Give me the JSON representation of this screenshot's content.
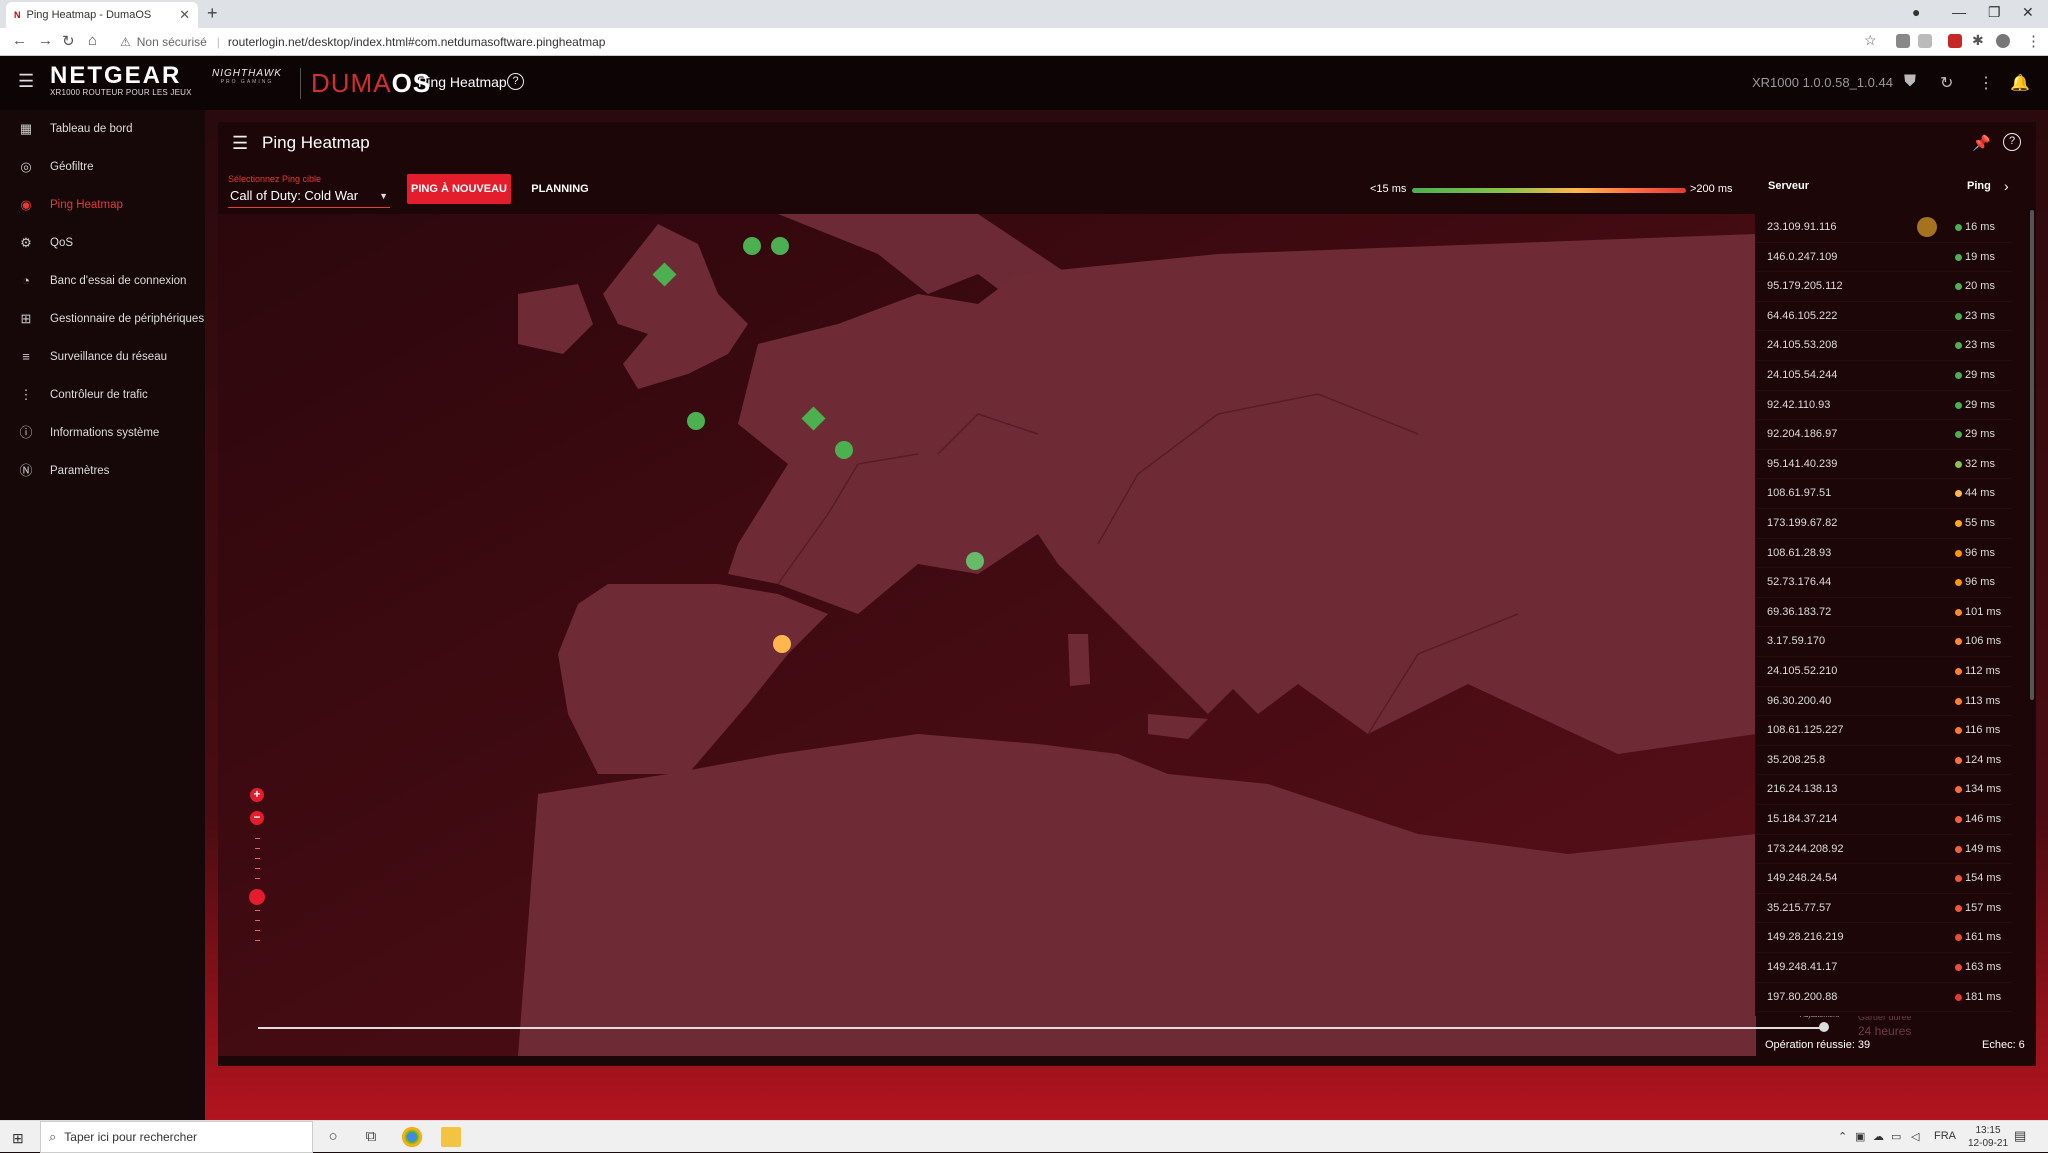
{
  "browser": {
    "tab_title": "Ping Heatmap - DumaOS",
    "tab_favicon": "N",
    "security_label": "Non sécurisé",
    "url": "routerlogin.net/desktop/index.html#com.netdumasoftware.pingheatmap"
  },
  "header": {
    "brand": "NETGEAR",
    "brand_sub": "XR1000 ROUTEUR POUR LES JEUX",
    "nighthawk": "NIGHTHAWK",
    "nighthawk_sub": "PRO GAMING",
    "duma": "DUMA",
    "os": "OS",
    "title": "Ping Heatmap",
    "version": "XR1000 1.0.0.58_1.0.44"
  },
  "sidebar": {
    "items": [
      {
        "label": "Tableau de bord",
        "icon": "dashboard-icon"
      },
      {
        "label": "Géofiltre",
        "icon": "geofilter-icon"
      },
      {
        "label": "Ping Heatmap",
        "icon": "ping-heatmap-icon",
        "active": true
      },
      {
        "label": "QoS",
        "icon": "qos-icon"
      },
      {
        "label": "Banc d'essai de connexion",
        "icon": "benchmark-icon"
      },
      {
        "label": "Gestionnaire de périphériques",
        "icon": "device-manager-icon"
      },
      {
        "label": "Surveillance du réseau",
        "icon": "network-monitor-icon"
      },
      {
        "label": "Contrôleur de trafic",
        "icon": "traffic-controller-icon"
      },
      {
        "label": "Informations système",
        "icon": "system-info-icon"
      },
      {
        "label": "Paramètres",
        "icon": "settings-icon"
      }
    ]
  },
  "card": {
    "title": "Ping Heatmap",
    "select_label": "Sélectionnez Ping cible",
    "selected_game": "Call of Duty: Cold War",
    "ping_again": "PING À NOUVEAU",
    "planning": "PLANNING",
    "legend_min": "<15 ms",
    "legend_max": ">200 ms"
  },
  "map": {
    "markers": [
      {
        "shape": "dot",
        "color": "#4caf50"
      },
      {
        "shape": "dot",
        "color": "#4caf50"
      },
      {
        "shape": "diamond",
        "color": "#4caf50"
      },
      {
        "shape": "dot",
        "color": "#4caf50"
      },
      {
        "shape": "diamond",
        "color": "#4caf50"
      },
      {
        "shape": "dot",
        "color": "#4caf50"
      },
      {
        "shape": "dot",
        "color": "#66bb6a"
      },
      {
        "shape": "dot",
        "color": "#ffb74d"
      }
    ],
    "timeline_hint": "Adjustement",
    "timeline_box_top": "Garder durée",
    "timeline_box_bottom": "24 heures"
  },
  "servers": {
    "header_server": "Serveur",
    "header_ping": "Ping",
    "rows": [
      {
        "ip": "23.109.91.116",
        "ping": "16 ms",
        "color": "#4caf50"
      },
      {
        "ip": "146.0.247.109",
        "ping": "19 ms",
        "color": "#4caf50"
      },
      {
        "ip": "95.179.205.112",
        "ping": "20 ms",
        "color": "#4caf50"
      },
      {
        "ip": "64.46.105.222",
        "ping": "23 ms",
        "color": "#4caf50"
      },
      {
        "ip": "24.105.53.208",
        "ping": "23 ms",
        "color": "#4caf50"
      },
      {
        "ip": "24.105.54.244",
        "ping": "29 ms",
        "color": "#4caf50"
      },
      {
        "ip": "92.42.110.93",
        "ping": "29 ms",
        "color": "#4caf50"
      },
      {
        "ip": "92.204.186.97",
        "ping": "29 ms",
        "color": "#4caf50"
      },
      {
        "ip": "95.141.40.239",
        "ping": "32 ms",
        "color": "#8bc34a"
      },
      {
        "ip": "108.61.97.51",
        "ping": "44 ms",
        "color": "#ffb74d"
      },
      {
        "ip": "173.199.67.82",
        "ping": "55 ms",
        "color": "#ffa726"
      },
      {
        "ip": "108.61.28.93",
        "ping": "96 ms",
        "color": "#ff9800"
      },
      {
        "ip": "52.73.176.44",
        "ping": "96 ms",
        "color": "#ff9800"
      },
      {
        "ip": "69.36.183.72",
        "ping": "101 ms",
        "color": "#ff8a30"
      },
      {
        "ip": "3.17.59.170",
        "ping": "106 ms",
        "color": "#ff8a30"
      },
      {
        "ip": "24.105.52.210",
        "ping": "112 ms",
        "color": "#ff7f30"
      },
      {
        "ip": "96.30.200.40",
        "ping": "113 ms",
        "color": "#ff7f30"
      },
      {
        "ip": "108.61.125.227",
        "ping": "116 ms",
        "color": "#ff7a30"
      },
      {
        "ip": "35.208.25.8",
        "ping": "124 ms",
        "color": "#ff7043"
      },
      {
        "ip": "216.24.138.13",
        "ping": "134 ms",
        "color": "#ff6a40"
      },
      {
        "ip": "15.184.37.214",
        "ping": "146 ms",
        "color": "#f4603e"
      },
      {
        "ip": "173.244.208.92",
        "ping": "149 ms",
        "color": "#f4603e"
      },
      {
        "ip": "149.248.24.54",
        "ping": "154 ms",
        "color": "#f0563c"
      },
      {
        "ip": "35.215.77.57",
        "ping": "157 ms",
        "color": "#f0563c"
      },
      {
        "ip": "149.28.216.219",
        "ping": "161 ms",
        "color": "#ec4c3a"
      },
      {
        "ip": "149.248.41.17",
        "ping": "163 ms",
        "color": "#ec4c3a"
      },
      {
        "ip": "197.80.200.88",
        "ping": "181 ms",
        "color": "#e53935"
      }
    ],
    "success": "Opération réussie: 39",
    "failure": "Echec: 6"
  },
  "taskbar": {
    "search_placeholder": "Taper ici pour rechercher",
    "lang": "FRA",
    "time": "13:15",
    "date": "12-09-21"
  }
}
